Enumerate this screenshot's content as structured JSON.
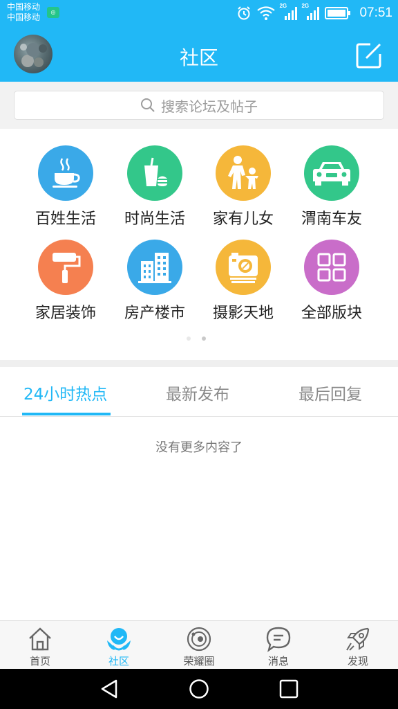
{
  "status_bar": {
    "carrier_1": "中国移动",
    "carrier_2": "中国移动",
    "sim1_label": "2G",
    "sim2_label": "2G",
    "time": "07:51"
  },
  "header": {
    "title": "社区",
    "accent_color": "#21b8f6"
  },
  "search": {
    "placeholder": "搜索论坛及帖子"
  },
  "categories": [
    {
      "label": "百姓生活",
      "color": "#3aa9e8",
      "icon": "coffee-cup-icon"
    },
    {
      "label": "时尚生活",
      "color": "#33c78a",
      "icon": "drink-burger-icon"
    },
    {
      "label": "家有儿女",
      "color": "#f5b73a",
      "icon": "parent-child-icon"
    },
    {
      "label": "渭南车友",
      "color": "#33c78a",
      "icon": "car-icon"
    },
    {
      "label": "家居装饰",
      "color": "#f58050",
      "icon": "paint-roller-icon"
    },
    {
      "label": "房产楼市",
      "color": "#3aa9e8",
      "icon": "buildings-icon"
    },
    {
      "label": "摄影天地",
      "color": "#f5b73a",
      "icon": "camera-icon"
    },
    {
      "label": "全部版块",
      "color": "#c96dc9",
      "icon": "grid-icon"
    }
  ],
  "tabs": [
    {
      "label": "24小时热点",
      "active": true
    },
    {
      "label": "最新发布",
      "active": false
    },
    {
      "label": "最后回复",
      "active": false
    }
  ],
  "empty_message": "没有更多内容了",
  "bottom_nav": [
    {
      "label": "首页",
      "icon": "home-icon",
      "active": false
    },
    {
      "label": "社区",
      "icon": "community-icon",
      "active": true
    },
    {
      "label": "荣耀圈",
      "icon": "planet-icon",
      "active": false
    },
    {
      "label": "消息",
      "icon": "message-icon",
      "active": false
    },
    {
      "label": "发现",
      "icon": "rocket-icon",
      "active": false
    }
  ]
}
